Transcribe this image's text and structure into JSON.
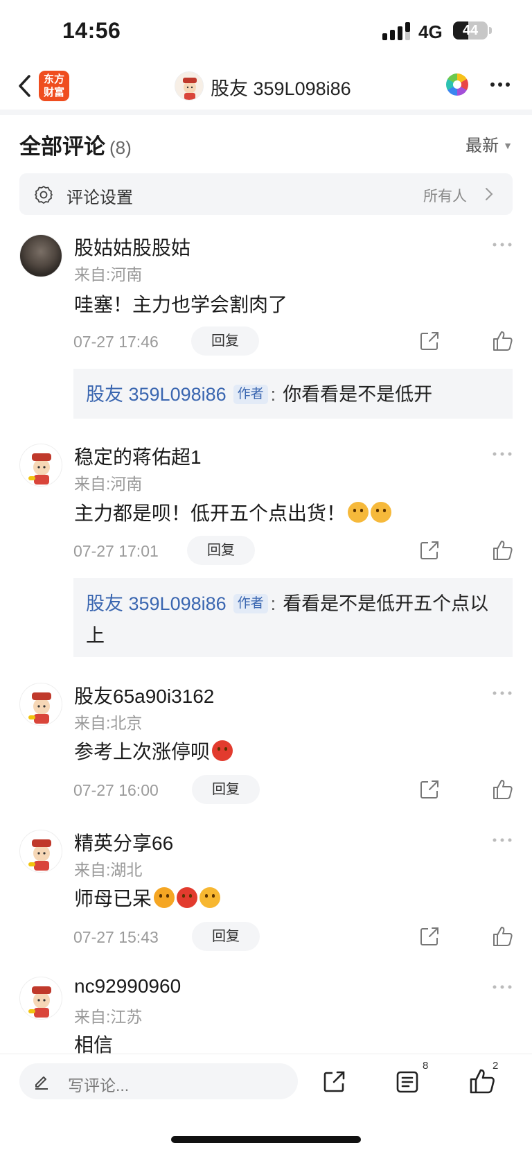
{
  "status_bar": {
    "time": "14:56",
    "network": "4G",
    "battery": "44",
    "battery_level_percent": 44
  },
  "nav": {
    "logo_line1": "东方",
    "logo_line2": "财富",
    "title": "股友 359L098i86"
  },
  "comments_header": {
    "title": "全部评论",
    "count": "(8)",
    "sort": "最新"
  },
  "settings": {
    "label": "评论设置",
    "value": "所有人"
  },
  "comments": [
    {
      "name": "股姑姑股股姑",
      "location": "来自:河南",
      "text": "哇塞！主力也学会割肉了",
      "time": "07-27 17:46",
      "reply_label": "回复",
      "reply": {
        "author": "股友 359L098i86",
        "tag": "作者",
        "colon": ":",
        "text": "你看看是不是低开"
      }
    },
    {
      "name": "稳定的蒋佑超1",
      "location": "来自:河南",
      "text": "主力都是呗！低开五个点出货！",
      "emojis": [
        "hug",
        "hug"
      ],
      "time": "07-27 17:01",
      "reply_label": "回复",
      "reply": {
        "author": "股友 359L098i86",
        "tag": "作者",
        "colon": ":",
        "text": "看看是不是低开五个点以上"
      }
    },
    {
      "name": "股友65a90i3162",
      "location": "来自:北京",
      "text": "参考上次涨停呗",
      "emojis": [
        "angry"
      ],
      "time": "07-27 16:00",
      "reply_label": "回复"
    },
    {
      "name": "精英分享66",
      "location": "来自:湖北",
      "text": "师母已呆",
      "emojis": [
        "confused",
        "angry",
        "cry"
      ],
      "time": "07-27 15:43",
      "reply_label": "回复"
    },
    {
      "name": "nc92990960",
      "location": "来自:江苏",
      "text": "相信"
    }
  ],
  "bottom_bar": {
    "placeholder": "写评论...",
    "list_badge": "8",
    "like_badge": "2"
  },
  "colors": {
    "accent_blue": "#3a66b0",
    "logo_orange": "#ef4d1f",
    "panel_gray": "#f4f5f7"
  }
}
